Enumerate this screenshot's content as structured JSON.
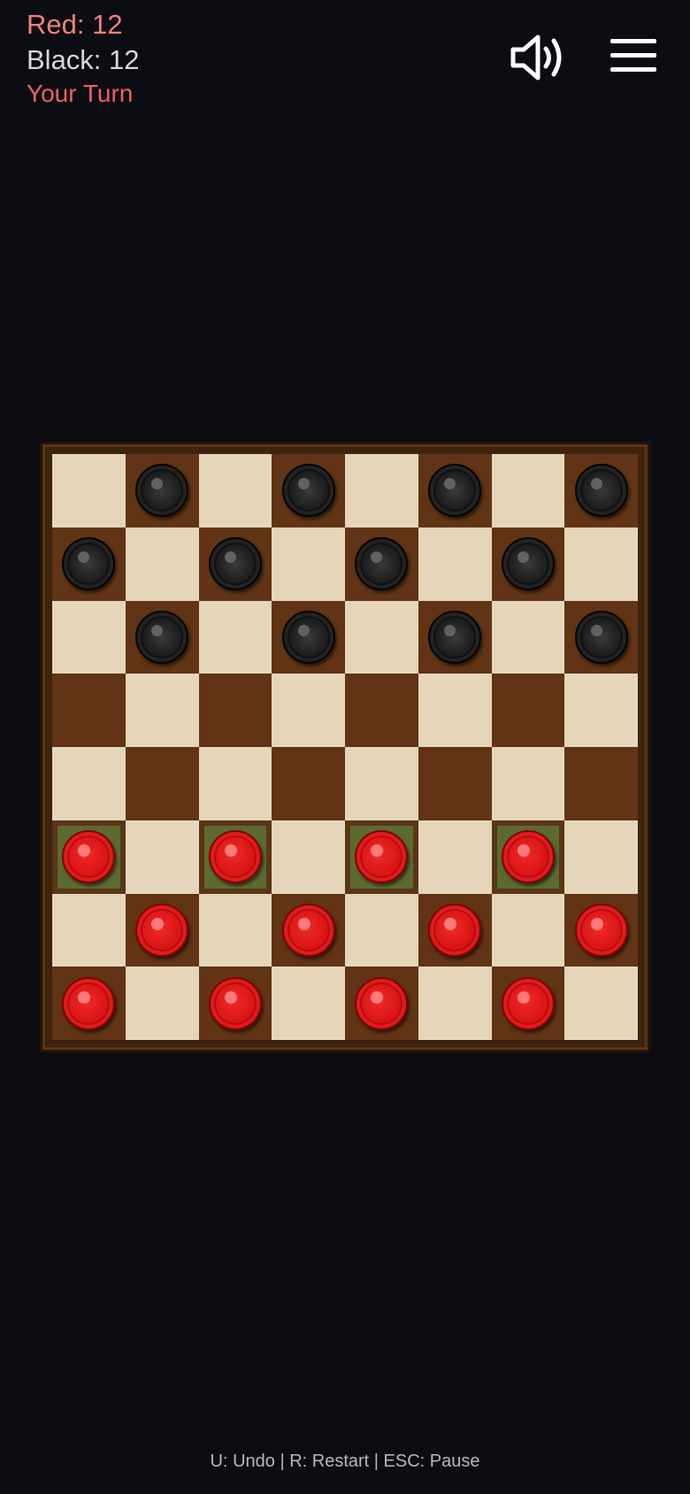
{
  "hud": {
    "red_score": "Red: 12",
    "black_score": "Black: 12",
    "turn": "Your Turn"
  },
  "controls": {
    "sound_icon": "speaker-volume-icon",
    "menu_icon": "hamburger-menu-icon"
  },
  "board": {
    "size": 8,
    "light_color": "#e5d6bb",
    "dark_color": "#603414",
    "highlight_color": "#5c6a30",
    "rows": [
      [
        "",
        "b",
        "",
        "b",
        "",
        "b",
        "",
        "b"
      ],
      [
        "b",
        "",
        "b",
        "",
        "b",
        "",
        "b",
        ""
      ],
      [
        "",
        "b",
        "",
        "b",
        "",
        "b",
        "",
        "b"
      ],
      [
        "",
        "",
        "",
        "",
        "",
        "",
        "",
        ""
      ],
      [
        "",
        "",
        "",
        "",
        "",
        "",
        "",
        ""
      ],
      [
        "r",
        "",
        "r",
        "",
        "r",
        "",
        "r",
        ""
      ],
      [
        "",
        "r",
        "",
        "r",
        "",
        "r",
        "",
        "r"
      ],
      [
        "r",
        "",
        "r",
        "",
        "r",
        "",
        "r",
        ""
      ]
    ],
    "movable": [
      [
        5,
        0
      ],
      [
        5,
        2
      ],
      [
        5,
        4
      ],
      [
        5,
        6
      ]
    ]
  },
  "footer": {
    "hint": "U: Undo | R: Restart | ESC: Pause"
  }
}
